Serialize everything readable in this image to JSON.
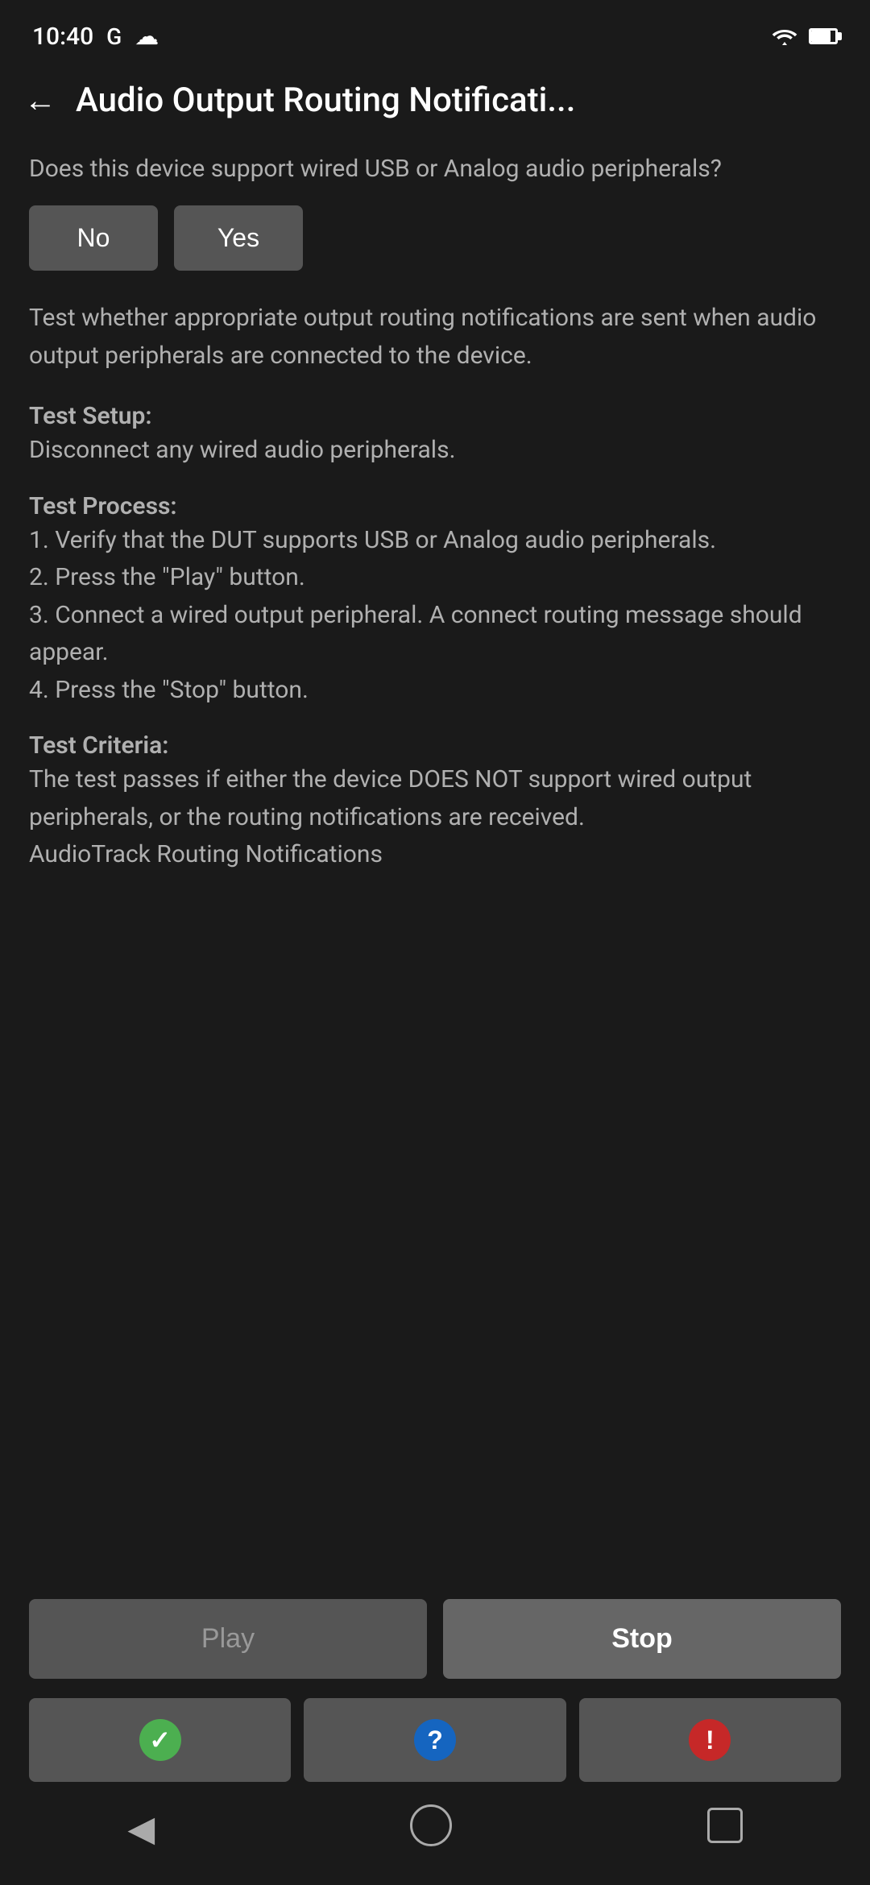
{
  "statusBar": {
    "time": "10:40",
    "googleIcon": "G",
    "cloudIcon": "cloud"
  },
  "header": {
    "backLabel": "←",
    "title": "Audio Output Routing Notificati..."
  },
  "questionSection": {
    "questionText": "Does this device support wired USB or Analog audio peripherals?",
    "noLabel": "No",
    "yesLabel": "Yes"
  },
  "descriptionSection": {
    "mainDescription": "Test whether appropriate output routing notifications are sent when audio output peripherals are connected to the device.",
    "testSetupLabel": "Test Setup:",
    "testSetupBody": "Disconnect any wired audio peripherals.",
    "testProcessLabel": "Test Process:",
    "testProcessBody": "1. Verify that the DUT supports USB or Analog audio peripherals.\n2. Press the \"Play\" button.\n3. Connect a wired output peripheral. A connect routing message should appear.\n4. Press the \"Stop\" button.",
    "testCriteriaLabel": "Test Criteria:",
    "testCriteriaBody": "The test passes if either the device DOES NOT support wired output peripherals, or the routing notifications are received.\nAudioTrack Routing Notifications"
  },
  "controls": {
    "playLabel": "Play",
    "stopLabel": "Stop",
    "passIconLabel": "✓",
    "infoIconLabel": "?",
    "errorIconLabel": "!"
  },
  "navBar": {
    "backLabel": "◀",
    "homeLabel": "circle",
    "recentLabel": "square"
  }
}
